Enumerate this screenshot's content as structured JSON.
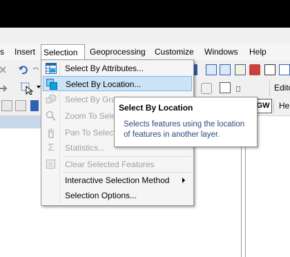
{
  "menubar": {
    "items": [
      {
        "label": "s"
      },
      {
        "label": "Insert"
      },
      {
        "label": "Selection"
      },
      {
        "label": "Geoprocessing"
      },
      {
        "label": "Customize"
      },
      {
        "label": "Windows"
      },
      {
        "label": "Help"
      }
    ]
  },
  "toolbar": {
    "editor_label": "Edito",
    "gw_label": "GW",
    "he_label": "He"
  },
  "selection_menu": {
    "items": [
      {
        "label": "Select By Attributes...",
        "enabled": true
      },
      {
        "label": "Select By Location...",
        "enabled": true,
        "highlighted": true
      },
      {
        "label": "Select By Graphi",
        "enabled": false
      },
      {
        "label": "Zoom To Sele",
        "enabled": false
      },
      {
        "label": "Pan To Selecte",
        "enabled": false
      },
      {
        "label": "Statistics...",
        "enabled": false
      },
      {
        "label": "Clear Selected Features",
        "enabled": false
      },
      {
        "label": "Interactive Selection Method",
        "enabled": true,
        "submenu": true
      },
      {
        "label": "Selection Options...",
        "enabled": true
      }
    ]
  },
  "tooltip": {
    "title": "Select By Location",
    "body": "Selects features using the location of features in another layer."
  },
  "colors": {
    "highlight_bg": "#cce4f7",
    "highlight_border": "#7eb4ea",
    "tooltip_text": "#2a4a7a"
  }
}
